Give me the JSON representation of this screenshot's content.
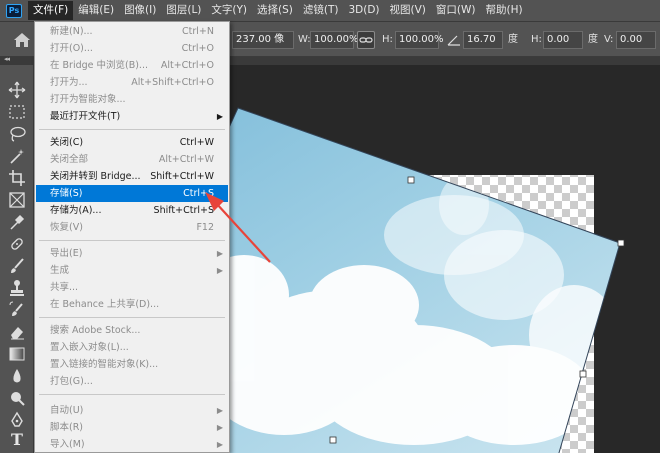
{
  "app": {
    "logo_text": "Ps"
  },
  "menubar": {
    "items": [
      "文件(F)",
      "编辑(E)",
      "图像(I)",
      "图层(L)",
      "文字(Y)",
      "选择(S)",
      "滤镜(T)",
      "3D(D)",
      "视图(V)",
      "窗口(W)",
      "帮助(H)"
    ],
    "active_index": 0
  },
  "options": {
    "partial_label": "ː",
    "y_value": "237.00 像",
    "w_label": "W:",
    "w_value": "100.00%",
    "h_label": "H:",
    "h_value": "100.00%",
    "angle_value": "16.70",
    "angle_unit": "度",
    "skew_h_label": "H:",
    "skew_h_value": "0.00",
    "skew_h_unit": "度",
    "skew_v_label": "V:",
    "skew_v_value": "0.00"
  },
  "file_menu": {
    "items": [
      {
        "label": "新建(N)...",
        "shortcut": "Ctrl+N",
        "disabled": true
      },
      {
        "label": "打开(O)...",
        "shortcut": "Ctrl+O",
        "disabled": true
      },
      {
        "label": "在 Bridge 中浏览(B)...",
        "shortcut": "Alt+Ctrl+O",
        "disabled": true
      },
      {
        "label": "打开为...",
        "shortcut": "Alt+Shift+Ctrl+O",
        "disabled": true
      },
      {
        "label": "打开为智能对象...",
        "shortcut": "",
        "disabled": true
      },
      {
        "label": "最近打开文件(T)",
        "shortcut": "",
        "submenu": true,
        "disabled": false
      },
      {
        "separator": true
      },
      {
        "label": "关闭(C)",
        "shortcut": "Ctrl+W",
        "disabled": false
      },
      {
        "label": "关闭全部",
        "shortcut": "Alt+Ctrl+W",
        "disabled": true
      },
      {
        "label": "关闭并转到 Bridge...",
        "shortcut": "Shift+Ctrl+W",
        "disabled": false
      },
      {
        "label": "存储(S)",
        "shortcut": "Ctrl+S",
        "disabled": false,
        "highlighted": true
      },
      {
        "label": "存储为(A)...",
        "shortcut": "Shift+Ctrl+S",
        "disabled": false
      },
      {
        "label": "恢复(V)",
        "shortcut": "F12",
        "disabled": true
      },
      {
        "separator": true
      },
      {
        "label": "导出(E)",
        "shortcut": "",
        "submenu": true,
        "disabled": true
      },
      {
        "label": "生成",
        "shortcut": "",
        "submenu": true,
        "disabled": true
      },
      {
        "label": "共享...",
        "shortcut": "",
        "disabled": true
      },
      {
        "label": "在 Behance 上共享(D)...",
        "shortcut": "",
        "disabled": true
      },
      {
        "separator": true
      },
      {
        "label": "搜索 Adobe Stock...",
        "shortcut": "",
        "disabled": true
      },
      {
        "label": "置入嵌入对象(L)...",
        "shortcut": "",
        "disabled": true
      },
      {
        "label": "置入链接的智能对象(K)...",
        "shortcut": "",
        "disabled": true
      },
      {
        "label": "打包(G)...",
        "shortcut": "",
        "disabled": true
      },
      {
        "separator": true
      },
      {
        "label": "自动(U)",
        "shortcut": "",
        "submenu": true,
        "disabled": true
      },
      {
        "label": "脚本(R)",
        "shortcut": "",
        "submenu": true,
        "disabled": true
      },
      {
        "label": "导入(M)",
        "shortcut": "",
        "submenu": true,
        "disabled": true
      }
    ]
  },
  "tools": [
    "move-tool",
    "marquee-tool",
    "lasso-tool",
    "magic-wand-tool",
    "crop-tool",
    "frame-tool",
    "eyedropper-tool",
    "healing-brush-tool",
    "brush-tool",
    "clone-stamp-tool",
    "history-brush-tool",
    "eraser-tool",
    "gradient-tool",
    "blur-tool",
    "dodge-tool",
    "pen-tool",
    "type-tool",
    "path-selection-tool"
  ],
  "colors": {
    "menu_highlight": "#0078d7",
    "annotation_arrow": "#e8443a",
    "sky": "#8cc3dc"
  }
}
